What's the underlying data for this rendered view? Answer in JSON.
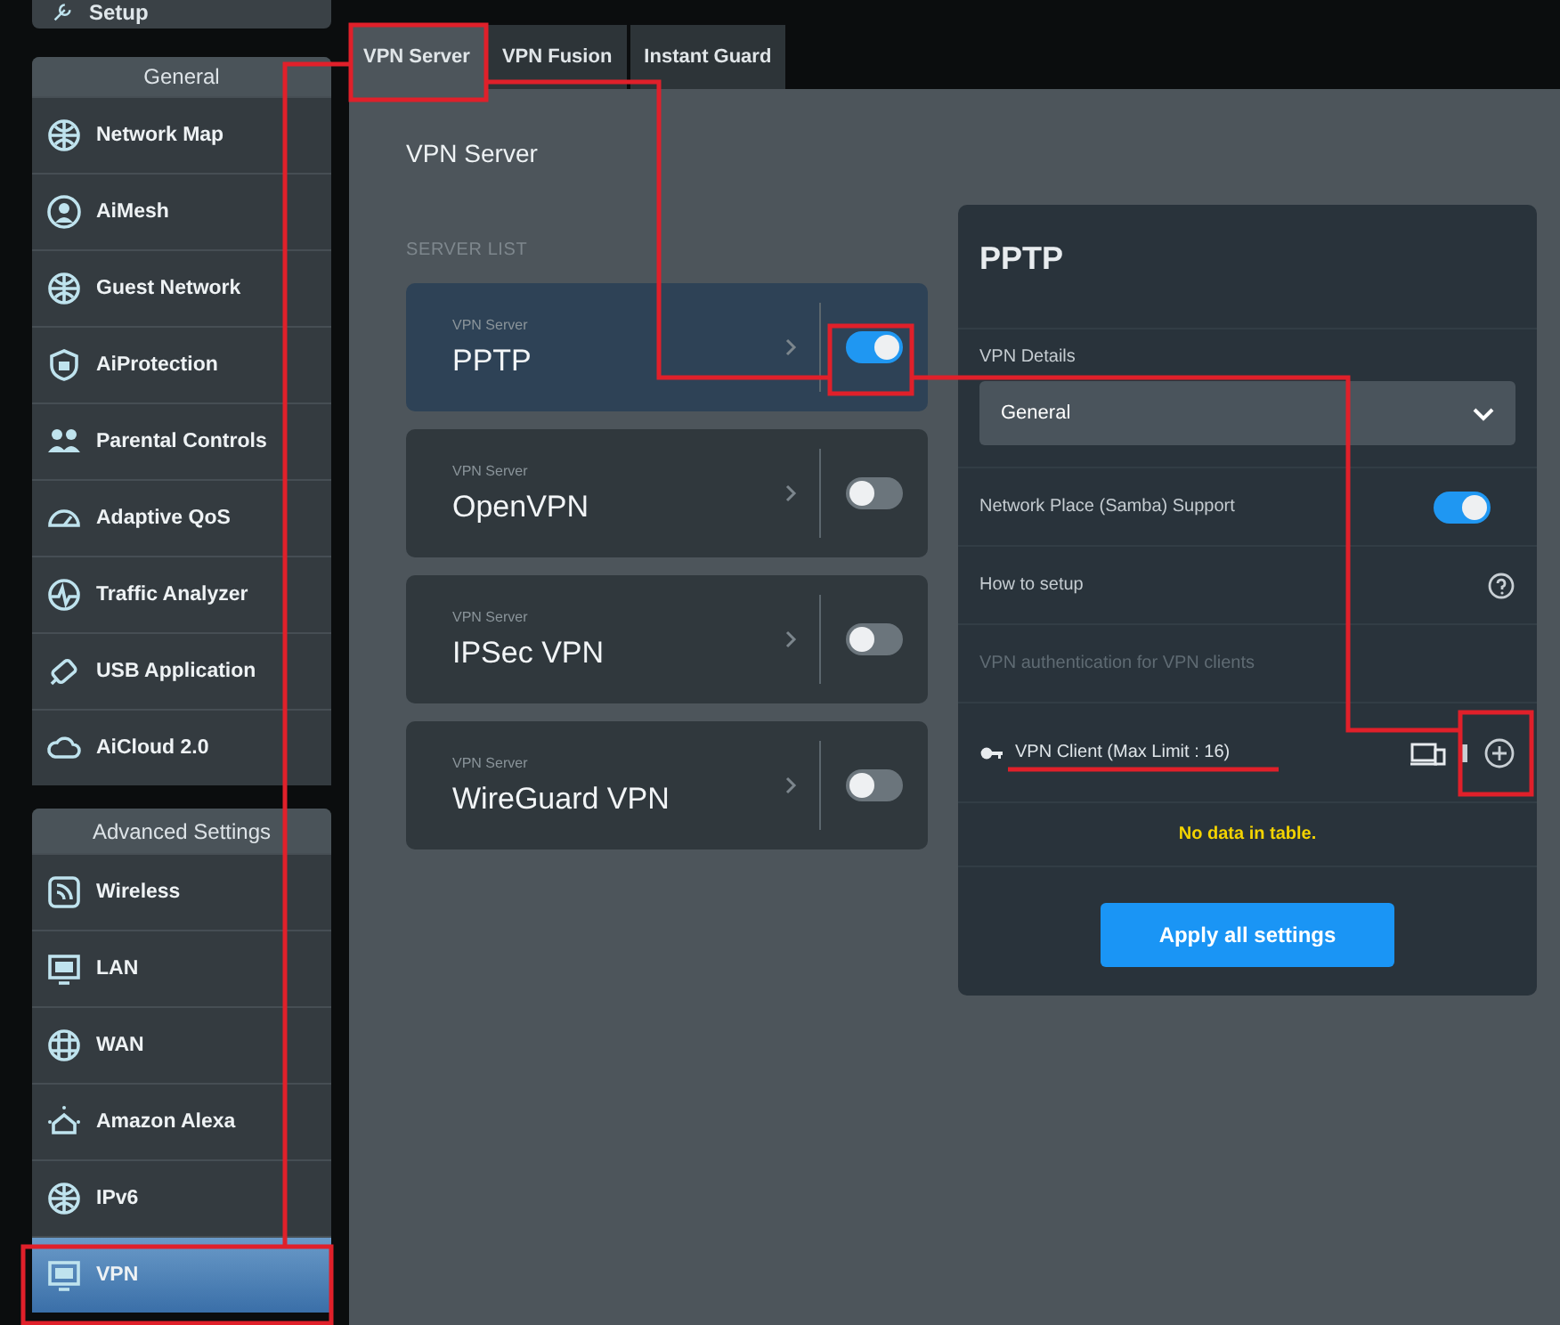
{
  "sidebar": {
    "top_item": {
      "label": "Setup"
    },
    "sections": [
      {
        "title": "General",
        "items": [
          {
            "label": "Network Map",
            "selected": false
          },
          {
            "label": "AiMesh",
            "selected": false
          },
          {
            "label": "Guest Network",
            "selected": false
          },
          {
            "label": "AiProtection",
            "selected": false
          },
          {
            "label": "Parental Controls",
            "selected": false
          },
          {
            "label": "Adaptive QoS",
            "selected": false
          },
          {
            "label": "Traffic Analyzer",
            "selected": false
          },
          {
            "label": "USB Application",
            "selected": false
          },
          {
            "label": "AiCloud 2.0",
            "selected": false
          }
        ]
      },
      {
        "title": "Advanced Settings",
        "items": [
          {
            "label": "Wireless",
            "selected": false
          },
          {
            "label": "LAN",
            "selected": false
          },
          {
            "label": "WAN",
            "selected": false
          },
          {
            "label": "Amazon Alexa",
            "selected": false
          },
          {
            "label": "IPv6",
            "selected": false
          },
          {
            "label": "VPN",
            "selected": true
          }
        ]
      }
    ]
  },
  "tabs": [
    {
      "label": "VPN Server",
      "selected": true
    },
    {
      "label": "VPN Fusion",
      "selected": false
    },
    {
      "label": "Instant Guard",
      "selected": false
    }
  ],
  "page_title": "VPN Server",
  "server_list": {
    "heading": "SERVER LIST",
    "servers": [
      {
        "caption": "VPN Server",
        "name": "PPTP",
        "selected": true,
        "on": true
      },
      {
        "caption": "VPN Server",
        "name": "OpenVPN",
        "selected": false,
        "on": false
      },
      {
        "caption": "VPN Server",
        "name": "IPSec VPN",
        "selected": false,
        "on": false
      },
      {
        "caption": "VPN Server",
        "name": "WireGuard VPN",
        "selected": false,
        "on": false
      }
    ]
  },
  "detail": {
    "title": "PPTP",
    "rows": [
      {
        "kind": "select",
        "label": "VPN Details",
        "value": "General"
      },
      {
        "kind": "toggle",
        "label": "Network Place (Samba) Support",
        "on": true
      },
      {
        "kind": "help",
        "label": "How to setup"
      },
      {
        "kind": "text",
        "label": "VPN authentication for VPN clients",
        "disabled": true
      },
      {
        "kind": "clients",
        "label": "VPN Client (Max Limit : 16)",
        "empty_message": "No data in table."
      }
    ],
    "apply_button": "Apply all settings"
  }
}
